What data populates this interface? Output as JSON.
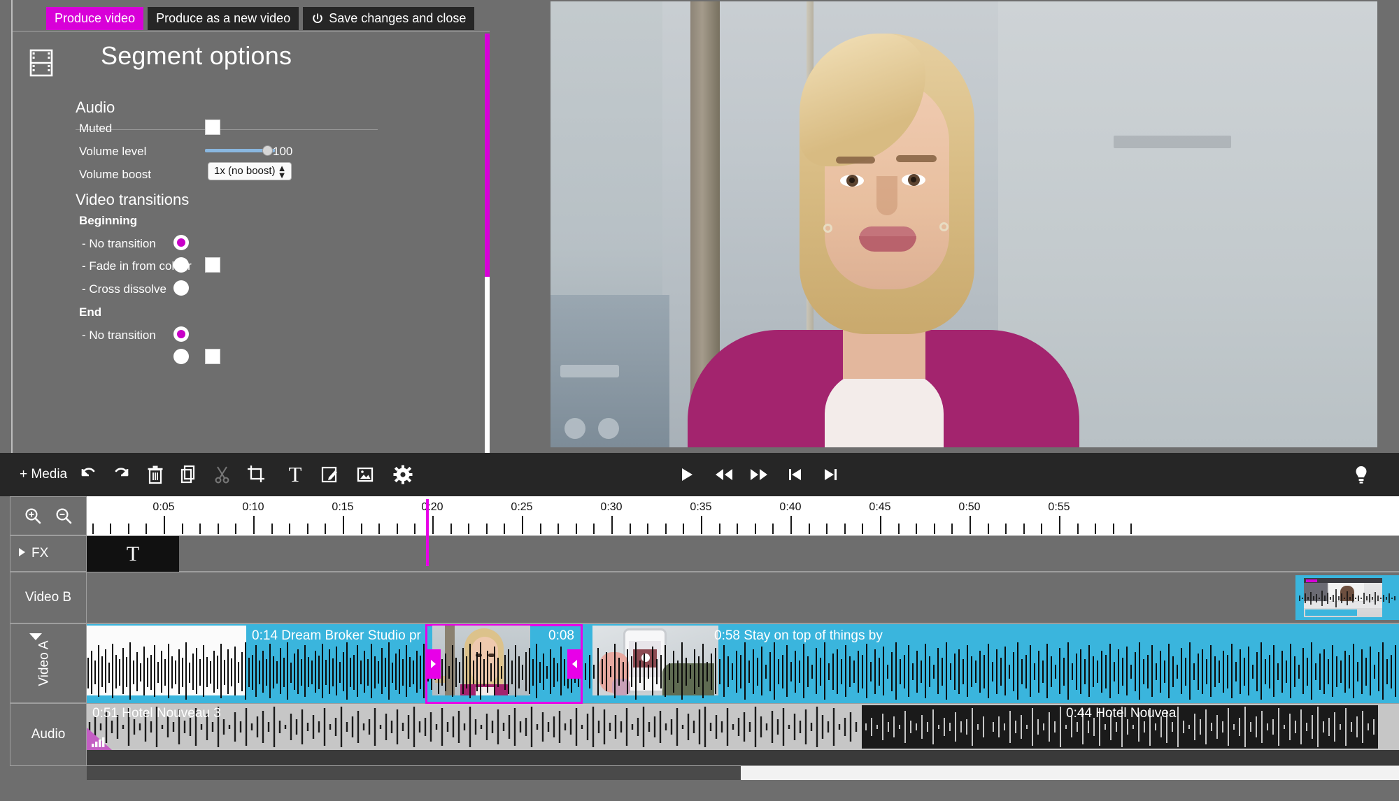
{
  "top_actions": [
    {
      "label": "Produce video",
      "style": "primary",
      "icon": null
    },
    {
      "label": "Produce as a new video",
      "style": "default",
      "icon": null
    },
    {
      "label": "Save changes and close",
      "style": "default",
      "icon": "power-icon"
    }
  ],
  "panel": {
    "icon": "film-strip-icon",
    "title": "Segment options",
    "sections": {
      "audio": {
        "heading": "Audio",
        "muted": {
          "label": "Muted",
          "checked": false
        },
        "volume_level": {
          "label": "Volume level",
          "value": "100",
          "percent": 85
        },
        "volume_boost": {
          "label": "Volume boost",
          "value": "1x (no boost)"
        }
      },
      "video_transitions": {
        "heading": "Video transitions",
        "beginning": {
          "label": "Beginning",
          "options": [
            {
              "label": "- No transition",
              "selected": true,
              "swatch": false
            },
            {
              "label": "- Fade in from colour",
              "selected": false,
              "swatch": true
            },
            {
              "label": "- Cross dissolve",
              "selected": false,
              "swatch": false
            }
          ]
        },
        "end": {
          "label": "End",
          "options": [
            {
              "label": "- No transition",
              "selected": true,
              "swatch": false
            }
          ]
        }
      }
    }
  },
  "toolbar": {
    "media_label": "+ Media",
    "tools": [
      {
        "name": "undo-icon",
        "enabled": true
      },
      {
        "name": "redo-icon",
        "enabled": true
      },
      {
        "name": "trash-icon",
        "enabled": true
      },
      {
        "name": "duplicate-icon",
        "enabled": true
      },
      {
        "name": "scissors-icon",
        "enabled": false
      },
      {
        "name": "crop-icon",
        "enabled": true
      },
      {
        "name": "text-icon",
        "enabled": true
      },
      {
        "name": "annotate-icon",
        "enabled": true
      },
      {
        "name": "image-icon",
        "enabled": true
      },
      {
        "name": "gear-icon",
        "enabled": true
      }
    ],
    "transport": [
      {
        "name": "play-icon"
      },
      {
        "name": "rewind-icon"
      },
      {
        "name": "fast-forward-icon"
      },
      {
        "name": "skip-start-icon"
      },
      {
        "name": "skip-end-icon"
      }
    ],
    "hint": {
      "name": "lightbulb-icon"
    }
  },
  "timeline": {
    "zoom_in": "zoom-in-icon",
    "zoom_out": "zoom-out-icon",
    "ruler": {
      "labels": [
        "0:05",
        "0:10",
        "0:15",
        "0:20",
        "0:25",
        "0:30",
        "0:35",
        "0:40",
        "0:45",
        "0:50",
        "0:55"
      ],
      "interval_seconds": 5,
      "minor_per_major": 5
    },
    "playhead_time": "0:15",
    "tracks": [
      {
        "name": "FX",
        "label": "FX",
        "collapsed": true,
        "caret": "caret-right"
      },
      {
        "name": "Video B",
        "label": "Video B",
        "collapsed": false,
        "caret": null
      },
      {
        "name": "Video A",
        "label": "Video A",
        "collapsed": false,
        "caret": "caret-down"
      },
      {
        "name": "Audio",
        "label": "Audio",
        "collapsed": false,
        "caret": null
      }
    ],
    "fx_clips": [
      {
        "label": "T",
        "kind": "text"
      }
    ],
    "video_b_clips": [
      {
        "label": "",
        "kind": "video"
      }
    ],
    "video_a_clips": [
      {
        "duration": "0:14",
        "title": "Dream Broker Studio pr",
        "label": "0:14 Dream Broker Studio pr",
        "selected": false
      },
      {
        "duration": "0:08",
        "title": "",
        "label": "0:08",
        "selected": true
      },
      {
        "duration": "0:58",
        "title": "Stay on top of things by",
        "label": "0:58 Stay on top of things by",
        "selected": false
      }
    ],
    "audio_clips": [
      {
        "duration": "0:51",
        "title": "Hotel Nouveau 3",
        "label": "0:51 Hotel Nouveau 3",
        "fade_in": true
      },
      {
        "duration": "0:44",
        "title": "Hotel Nouvea",
        "label": "0:44 Hotel Nouvea",
        "fade_in": false
      }
    ]
  },
  "colors": {
    "accent_magenta": "#d800d8",
    "clip_blue": "#3ab5dd",
    "audio_grey": "#c6c6c6",
    "toolbar_dark": "#262626",
    "panel_grey": "#6e6e6e"
  }
}
